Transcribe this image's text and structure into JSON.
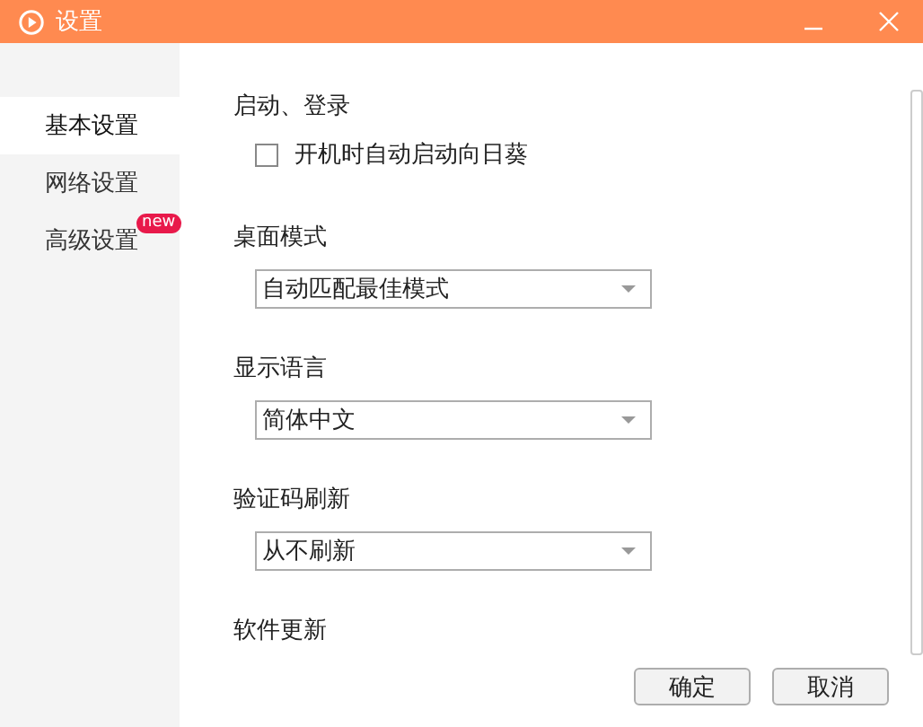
{
  "window": {
    "title": "设置"
  },
  "sidebar": {
    "items": [
      {
        "label": "基本设置",
        "selected": true
      },
      {
        "label": "网络设置",
        "selected": false
      },
      {
        "label": "高级设置",
        "selected": false,
        "badge": "new"
      }
    ]
  },
  "sections": [
    {
      "kind": "checkbox",
      "title": "启动、登录",
      "label": "开机时自动启动向日葵",
      "checked": false
    },
    {
      "kind": "select",
      "title": "桌面模式",
      "value": "自动匹配最佳模式"
    },
    {
      "kind": "select",
      "title": "显示语言",
      "value": "简体中文"
    },
    {
      "kind": "select",
      "title": "验证码刷新",
      "value": "从不刷新"
    },
    {
      "kind": "heading",
      "title": "软件更新"
    }
  ],
  "buttons": [
    {
      "label": "确定"
    },
    {
      "label": "取消"
    }
  ]
}
